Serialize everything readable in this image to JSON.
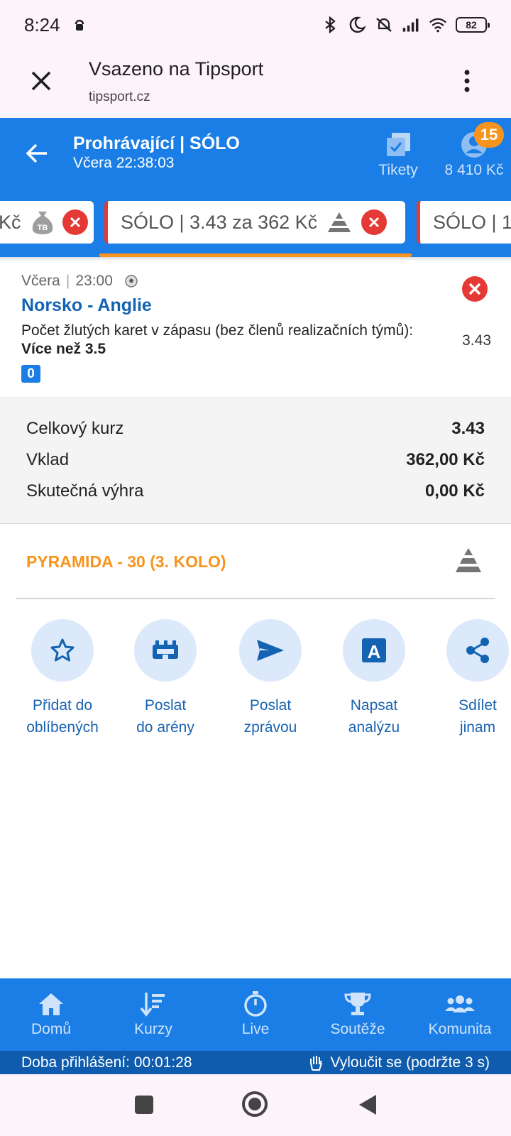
{
  "status_bar": {
    "time": "8:24",
    "battery": "82"
  },
  "browser": {
    "title": "Vsazeno na Tipsport",
    "url": "tipsport.cz"
  },
  "header": {
    "title": "Prohrávající | SÓLO",
    "subtitle": "Včera 22:38:03",
    "tickets_label": "Tikety",
    "balance": "8 410 Kč",
    "badge_count": "15"
  },
  "ticket_tabs": [
    {
      "label": "Kč"
    },
    {
      "label": "SÓLO  | 3.43 za 362 Kč"
    },
    {
      "label": "SÓLO  | 1"
    }
  ],
  "bet": {
    "date": "Včera",
    "time": "23:00",
    "match": "Norsko - Anglie",
    "market": "Počet žlutých karet v zápasu (bez členů realizačních týmů):",
    "pick": "Více než 3.5",
    "odd": "3.43",
    "number": "0"
  },
  "summary": {
    "rows": [
      {
        "label": "Celkový kurz",
        "value": "3.43"
      },
      {
        "label": "Vklad",
        "value": "362,00 Kč"
      },
      {
        "label": "Skutečná výhra",
        "value": "0,00 Kč"
      }
    ]
  },
  "pyramid": {
    "label": "PYRAMIDA - 30 (3. KOLO)"
  },
  "actions": [
    {
      "line1": "Přidat do",
      "line2": "oblíbených",
      "icon": "star-icon"
    },
    {
      "line1": "Poslat",
      "line2": "do arény",
      "icon": "arena-icon"
    },
    {
      "line1": "Poslat",
      "line2": "zprávou",
      "icon": "send-icon"
    },
    {
      "line1": "Napsat",
      "line2": "analýzu",
      "icon": "analysis-icon"
    },
    {
      "line1": "Sdílet",
      "line2": "jinam",
      "icon": "share-icon"
    }
  ],
  "bottom_nav": [
    {
      "label": "Domů",
      "icon": "home-icon"
    },
    {
      "label": "Kurzy",
      "icon": "odds-icon"
    },
    {
      "label": "Live",
      "icon": "stopwatch-icon"
    },
    {
      "label": "Soutěže",
      "icon": "trophy-icon"
    },
    {
      "label": "Komunita",
      "icon": "community-icon"
    }
  ],
  "login_bar": {
    "duration": "Doba přihlášení: 00:01:28",
    "exclude": "Vyloučit se (podržte 3 s)"
  },
  "colors": {
    "brand_blue": "#1a7ee6",
    "accent_orange": "#f7941d",
    "danger_red": "#e53935",
    "link_blue": "#1463b3"
  }
}
